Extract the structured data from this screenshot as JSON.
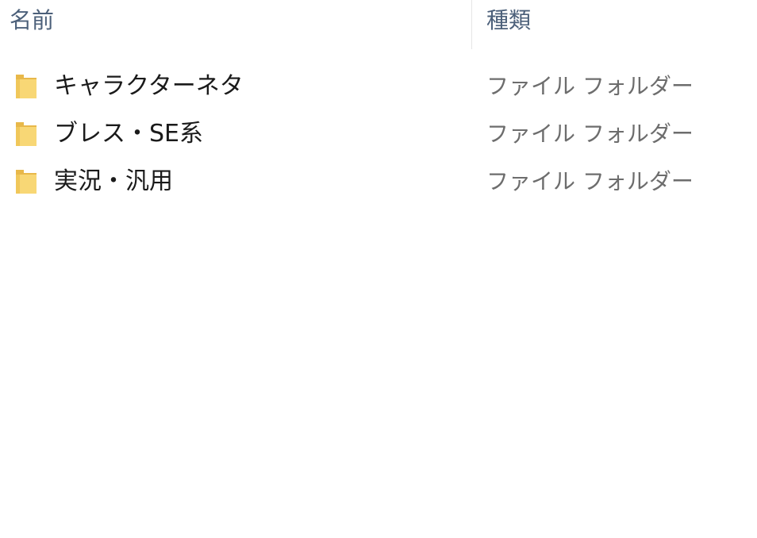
{
  "columns": {
    "name": "名前",
    "type": "種類"
  },
  "rows": [
    {
      "name": "キャラクターネタ",
      "type": "ファイル フォルダー",
      "icon": "folder-icon"
    },
    {
      "name": "ブレス・SE系",
      "type": "ファイル フォルダー",
      "icon": "folder-icon"
    },
    {
      "name": "実況・汎用",
      "type": "ファイル フォルダー",
      "icon": "folder-icon"
    }
  ],
  "colors": {
    "header_text": "#4c607a",
    "item_text": "#1a1a1a",
    "type_text": "#6d6d6d",
    "folder_yellow": "#f8d775",
    "folder_dark": "#e8b84a"
  }
}
